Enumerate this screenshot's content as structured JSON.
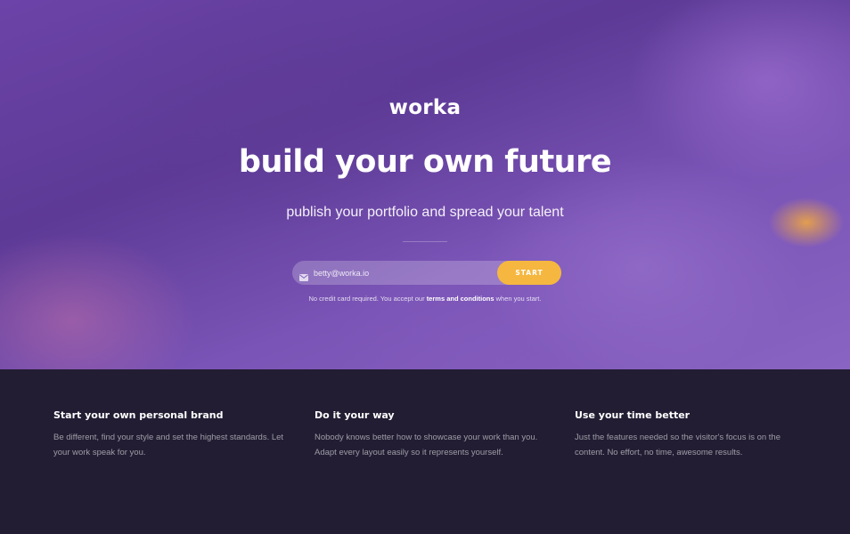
{
  "hero": {
    "logo": "worka",
    "headline": "build your own future",
    "subheadline": "publish your portfolio and spread your talent",
    "signup": {
      "email_value": "betty@worka.io",
      "email_placeholder": "betty@worka.io",
      "mail_icon": "envelope-icon",
      "button_label": "START"
    },
    "disclaimer": {
      "before": "No credit card required. You accept our ",
      "link": "terms and conditions",
      "after": " when you start."
    }
  },
  "features": [
    {
      "title": "Start your own personal brand",
      "text": "Be different, find your style and set the highest standards. Let your work speak for you."
    },
    {
      "title": "Do it your way",
      "text": "Nobody knows better how to showcase your work than you. Adapt every layout easily so it represents yourself."
    },
    {
      "title": "Use your time better",
      "text": "Just the features needed so the visitor's focus is on the content. No effort, no time, awesome results."
    }
  ],
  "colors": {
    "accent": "#f5b73f",
    "hero_purple": "#6c43a8",
    "footer_bg": "#221d33"
  }
}
